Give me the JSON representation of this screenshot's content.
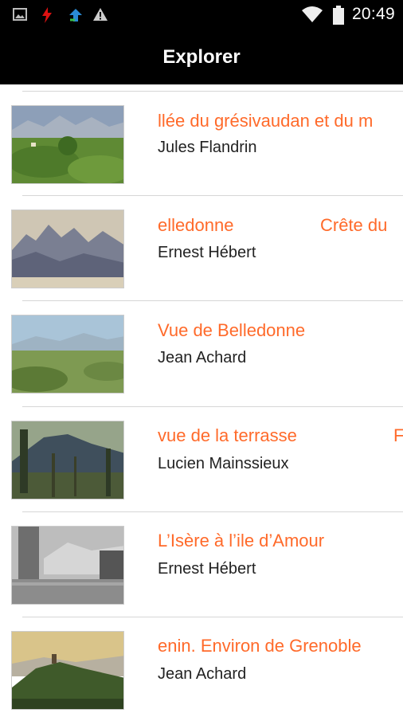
{
  "status_bar": {
    "time": "20:49",
    "left_icons": [
      "image-icon",
      "flash-icon",
      "upload-icon",
      "warning-icon"
    ],
    "right_icons": [
      "wifi-icon",
      "battery-icon"
    ]
  },
  "app_bar": {
    "title": "Explorer"
  },
  "colors": {
    "accent": "#ff6a2a",
    "bar": "#000000",
    "divider": "#d6d6d6"
  },
  "items": [
    {
      "title": "llée du grésivaudan et du m",
      "title_tail": "",
      "artist": "Jules Flandrin"
    },
    {
      "title": "elledonne",
      "title_tail": "Crête du",
      "artist": "Ernest Hébert"
    },
    {
      "title": "Vue de Belledonne",
      "title_tail": "",
      "artist": "Jean Achard"
    },
    {
      "title": "vue de la terrasse",
      "title_tail": "F",
      "artist": "Lucien Mainssieux"
    },
    {
      "title": "L’Isère à l’ile d’Amour",
      "title_tail": "",
      "artist": "Ernest Hébert"
    },
    {
      "title": "enin. Environ de Grenoble",
      "title_tail": "",
      "artist": "Jean Achard"
    }
  ]
}
